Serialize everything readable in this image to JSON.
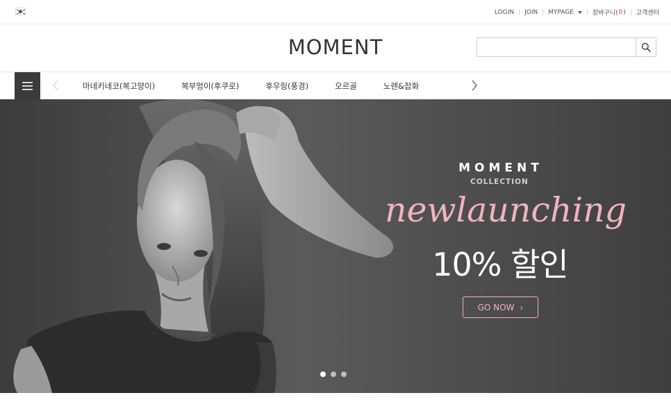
{
  "topbar": {
    "flag_icon": "korea-flag-icon",
    "links": [
      {
        "label": "LOGIN"
      },
      {
        "label": "JOIN"
      },
      {
        "label": "MYPAGE"
      },
      {
        "label": "장바구니("
      },
      {
        "label": "고객센터"
      }
    ],
    "cart_count": "0",
    "cart_close": ")"
  },
  "header": {
    "logo": "MOMENT",
    "search": {
      "placeholder": "",
      "value": "",
      "icon": "search-icon"
    }
  },
  "nav": {
    "menu_icon": "hamburger-icon",
    "prev_icon": "chevron-left-icon",
    "next_icon": "chevron-right-icon",
    "categories": [
      "마네키네코(복고양이)",
      "복부엉이(후쿠로)",
      "후우링(풍경)",
      "오르골",
      "노렌&잡화"
    ]
  },
  "hero": {
    "brand": "MOMENT",
    "collection": "COLLECTION",
    "script_text": "newlaunching",
    "promo": "10% 할인",
    "cta_label": "GO NOW",
    "cta_icon": "chevron-right-icon",
    "slide_count": 3,
    "active_slide": 1,
    "accent_color": "#f0b2c4"
  },
  "colors": {
    "menu_button": "#3b3b3b",
    "cart_count": "#c0395c"
  }
}
